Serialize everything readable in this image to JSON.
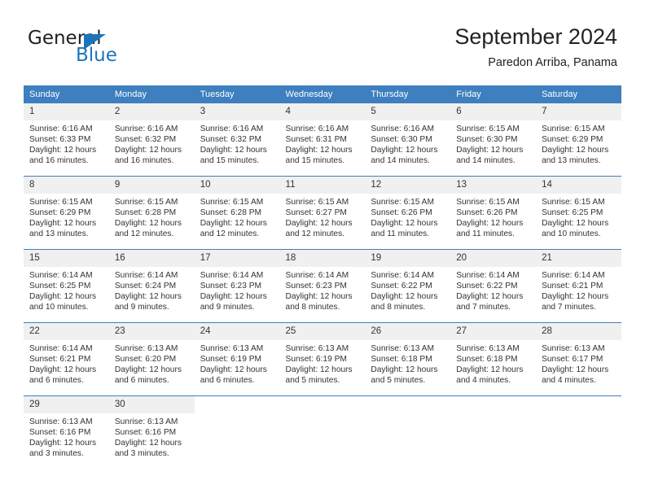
{
  "logo": {
    "primary_text": "General",
    "secondary_text": "Blue",
    "primary_color": "#231f20",
    "accent_color": "#1c75bc",
    "triangle_icon": "triangle-icon"
  },
  "header": {
    "title": "September 2024",
    "subtitle": "Paredon Arriba, Panama"
  },
  "theme": {
    "header_row_bg": "#3d7fbf",
    "header_row_text": "#ffffff",
    "daynum_bg": "#f0f0f0",
    "row_divider": "#3d7fbf",
    "body_text": "#333333"
  },
  "weekday_headers": [
    "Sunday",
    "Monday",
    "Tuesday",
    "Wednesday",
    "Thursday",
    "Friday",
    "Saturday"
  ],
  "weeks": [
    [
      {
        "day": "1",
        "sunrise": "Sunrise: 6:16 AM",
        "sunset": "Sunset: 6:33 PM",
        "daylight_line1": "Daylight: 12 hours",
        "daylight_line2": "and 16 minutes."
      },
      {
        "day": "2",
        "sunrise": "Sunrise: 6:16 AM",
        "sunset": "Sunset: 6:32 PM",
        "daylight_line1": "Daylight: 12 hours",
        "daylight_line2": "and 16 minutes."
      },
      {
        "day": "3",
        "sunrise": "Sunrise: 6:16 AM",
        "sunset": "Sunset: 6:32 PM",
        "daylight_line1": "Daylight: 12 hours",
        "daylight_line2": "and 15 minutes."
      },
      {
        "day": "4",
        "sunrise": "Sunrise: 6:16 AM",
        "sunset": "Sunset: 6:31 PM",
        "daylight_line1": "Daylight: 12 hours",
        "daylight_line2": "and 15 minutes."
      },
      {
        "day": "5",
        "sunrise": "Sunrise: 6:16 AM",
        "sunset": "Sunset: 6:30 PM",
        "daylight_line1": "Daylight: 12 hours",
        "daylight_line2": "and 14 minutes."
      },
      {
        "day": "6",
        "sunrise": "Sunrise: 6:15 AM",
        "sunset": "Sunset: 6:30 PM",
        "daylight_line1": "Daylight: 12 hours",
        "daylight_line2": "and 14 minutes."
      },
      {
        "day": "7",
        "sunrise": "Sunrise: 6:15 AM",
        "sunset": "Sunset: 6:29 PM",
        "daylight_line1": "Daylight: 12 hours",
        "daylight_line2": "and 13 minutes."
      }
    ],
    [
      {
        "day": "8",
        "sunrise": "Sunrise: 6:15 AM",
        "sunset": "Sunset: 6:29 PM",
        "daylight_line1": "Daylight: 12 hours",
        "daylight_line2": "and 13 minutes."
      },
      {
        "day": "9",
        "sunrise": "Sunrise: 6:15 AM",
        "sunset": "Sunset: 6:28 PM",
        "daylight_line1": "Daylight: 12 hours",
        "daylight_line2": "and 12 minutes."
      },
      {
        "day": "10",
        "sunrise": "Sunrise: 6:15 AM",
        "sunset": "Sunset: 6:28 PM",
        "daylight_line1": "Daylight: 12 hours",
        "daylight_line2": "and 12 minutes."
      },
      {
        "day": "11",
        "sunrise": "Sunrise: 6:15 AM",
        "sunset": "Sunset: 6:27 PM",
        "daylight_line1": "Daylight: 12 hours",
        "daylight_line2": "and 12 minutes."
      },
      {
        "day": "12",
        "sunrise": "Sunrise: 6:15 AM",
        "sunset": "Sunset: 6:26 PM",
        "daylight_line1": "Daylight: 12 hours",
        "daylight_line2": "and 11 minutes."
      },
      {
        "day": "13",
        "sunrise": "Sunrise: 6:15 AM",
        "sunset": "Sunset: 6:26 PM",
        "daylight_line1": "Daylight: 12 hours",
        "daylight_line2": "and 11 minutes."
      },
      {
        "day": "14",
        "sunrise": "Sunrise: 6:15 AM",
        "sunset": "Sunset: 6:25 PM",
        "daylight_line1": "Daylight: 12 hours",
        "daylight_line2": "and 10 minutes."
      }
    ],
    [
      {
        "day": "15",
        "sunrise": "Sunrise: 6:14 AM",
        "sunset": "Sunset: 6:25 PM",
        "daylight_line1": "Daylight: 12 hours",
        "daylight_line2": "and 10 minutes."
      },
      {
        "day": "16",
        "sunrise": "Sunrise: 6:14 AM",
        "sunset": "Sunset: 6:24 PM",
        "daylight_line1": "Daylight: 12 hours",
        "daylight_line2": "and 9 minutes."
      },
      {
        "day": "17",
        "sunrise": "Sunrise: 6:14 AM",
        "sunset": "Sunset: 6:23 PM",
        "daylight_line1": "Daylight: 12 hours",
        "daylight_line2": "and 9 minutes."
      },
      {
        "day": "18",
        "sunrise": "Sunrise: 6:14 AM",
        "sunset": "Sunset: 6:23 PM",
        "daylight_line1": "Daylight: 12 hours",
        "daylight_line2": "and 8 minutes."
      },
      {
        "day": "19",
        "sunrise": "Sunrise: 6:14 AM",
        "sunset": "Sunset: 6:22 PM",
        "daylight_line1": "Daylight: 12 hours",
        "daylight_line2": "and 8 minutes."
      },
      {
        "day": "20",
        "sunrise": "Sunrise: 6:14 AM",
        "sunset": "Sunset: 6:22 PM",
        "daylight_line1": "Daylight: 12 hours",
        "daylight_line2": "and 7 minutes."
      },
      {
        "day": "21",
        "sunrise": "Sunrise: 6:14 AM",
        "sunset": "Sunset: 6:21 PM",
        "daylight_line1": "Daylight: 12 hours",
        "daylight_line2": "and 7 minutes."
      }
    ],
    [
      {
        "day": "22",
        "sunrise": "Sunrise: 6:14 AM",
        "sunset": "Sunset: 6:21 PM",
        "daylight_line1": "Daylight: 12 hours",
        "daylight_line2": "and 6 minutes."
      },
      {
        "day": "23",
        "sunrise": "Sunrise: 6:13 AM",
        "sunset": "Sunset: 6:20 PM",
        "daylight_line1": "Daylight: 12 hours",
        "daylight_line2": "and 6 minutes."
      },
      {
        "day": "24",
        "sunrise": "Sunrise: 6:13 AM",
        "sunset": "Sunset: 6:19 PM",
        "daylight_line1": "Daylight: 12 hours",
        "daylight_line2": "and 6 minutes."
      },
      {
        "day": "25",
        "sunrise": "Sunrise: 6:13 AM",
        "sunset": "Sunset: 6:19 PM",
        "daylight_line1": "Daylight: 12 hours",
        "daylight_line2": "and 5 minutes."
      },
      {
        "day": "26",
        "sunrise": "Sunrise: 6:13 AM",
        "sunset": "Sunset: 6:18 PM",
        "daylight_line1": "Daylight: 12 hours",
        "daylight_line2": "and 5 minutes."
      },
      {
        "day": "27",
        "sunrise": "Sunrise: 6:13 AM",
        "sunset": "Sunset: 6:18 PM",
        "daylight_line1": "Daylight: 12 hours",
        "daylight_line2": "and 4 minutes."
      },
      {
        "day": "28",
        "sunrise": "Sunrise: 6:13 AM",
        "sunset": "Sunset: 6:17 PM",
        "daylight_line1": "Daylight: 12 hours",
        "daylight_line2": "and 4 minutes."
      }
    ],
    [
      {
        "day": "29",
        "sunrise": "Sunrise: 6:13 AM",
        "sunset": "Sunset: 6:16 PM",
        "daylight_line1": "Daylight: 12 hours",
        "daylight_line2": "and 3 minutes."
      },
      {
        "day": "30",
        "sunrise": "Sunrise: 6:13 AM",
        "sunset": "Sunset: 6:16 PM",
        "daylight_line1": "Daylight: 12 hours",
        "daylight_line2": "and 3 minutes."
      },
      {
        "day": "",
        "sunrise": "",
        "sunset": "",
        "daylight_line1": "",
        "daylight_line2": ""
      },
      {
        "day": "",
        "sunrise": "",
        "sunset": "",
        "daylight_line1": "",
        "daylight_line2": ""
      },
      {
        "day": "",
        "sunrise": "",
        "sunset": "",
        "daylight_line1": "",
        "daylight_line2": ""
      },
      {
        "day": "",
        "sunrise": "",
        "sunset": "",
        "daylight_line1": "",
        "daylight_line2": ""
      },
      {
        "day": "",
        "sunrise": "",
        "sunset": "",
        "daylight_line1": "",
        "daylight_line2": ""
      }
    ]
  ]
}
